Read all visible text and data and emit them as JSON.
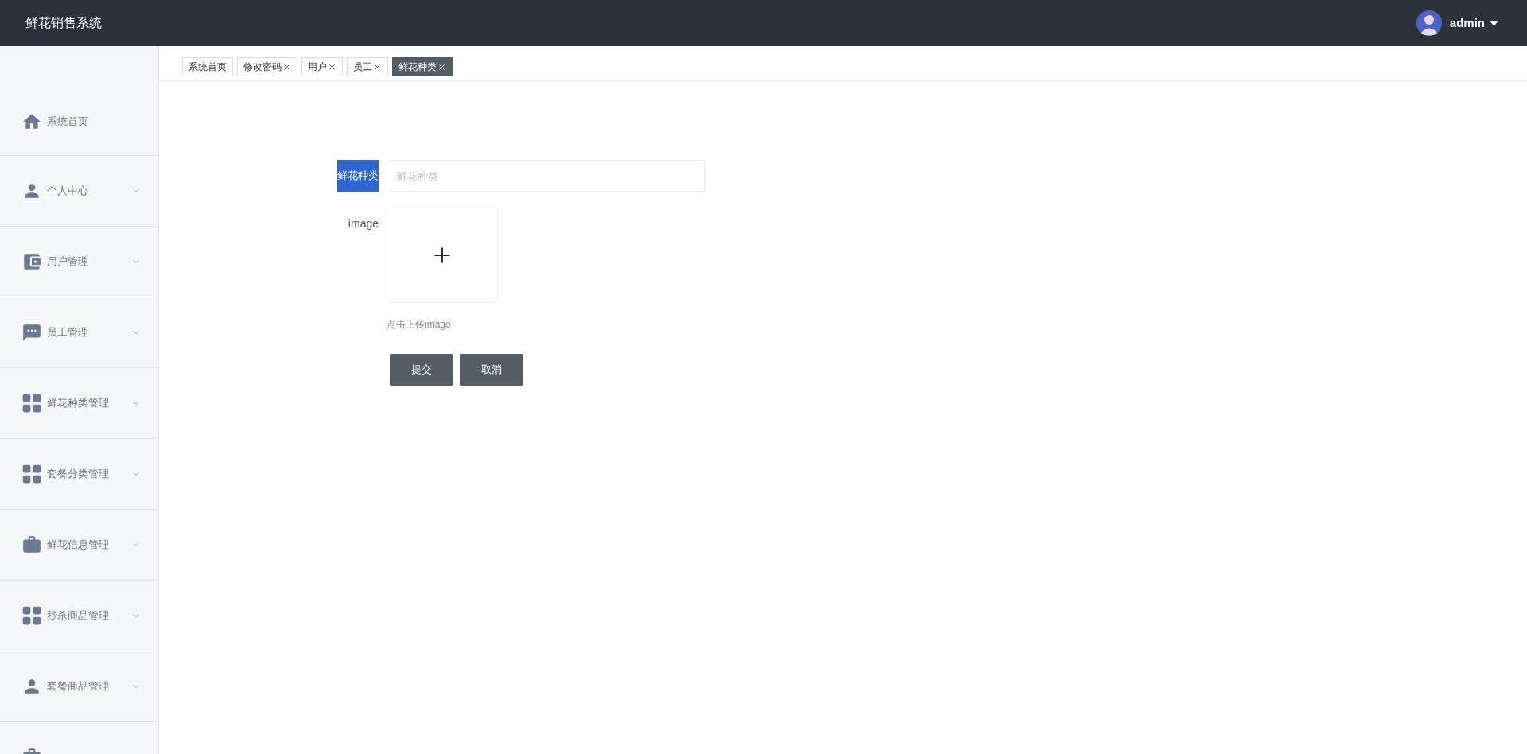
{
  "header": {
    "title": "鲜花销售系统",
    "user": "admin"
  },
  "sidebar": {
    "items": [
      {
        "kind": "home",
        "label": "系统首页",
        "expandable": false
      },
      {
        "kind": "person",
        "label": "个人中心",
        "expandable": true
      },
      {
        "kind": "wallet",
        "label": "用户管理",
        "expandable": true
      },
      {
        "kind": "chat",
        "label": "员工管理",
        "expandable": true
      },
      {
        "kind": "grid",
        "label": "鲜花种类管理",
        "expandable": true
      },
      {
        "kind": "grid",
        "label": "套餐分类管理",
        "expandable": true
      },
      {
        "kind": "briefcase",
        "label": "鲜花信息管理",
        "expandable": true
      },
      {
        "kind": "grid",
        "label": "秒杀商品管理",
        "expandable": true
      },
      {
        "kind": "person",
        "label": "套餐商品管理",
        "expandable": true
      },
      {
        "kind": "briefcase"
      }
    ]
  },
  "tabs": [
    {
      "label": "系统首页",
      "closable": false,
      "selected": false
    },
    {
      "label": "修改密码",
      "closable": true,
      "selected": false
    },
    {
      "label": "用户",
      "closable": true,
      "selected": false
    },
    {
      "label": "员工",
      "closable": true,
      "selected": false
    },
    {
      "label": "鲜花种类",
      "closable": true,
      "selected": true
    }
  ],
  "form": {
    "name_field": {
      "label": "鲜花种类",
      "label_highlighted": true,
      "placeholder": "鲜花种类"
    },
    "image_field": {
      "label": "image",
      "hint": "点击上传image"
    },
    "buttons": [
      "提交",
      "取消"
    ]
  }
}
